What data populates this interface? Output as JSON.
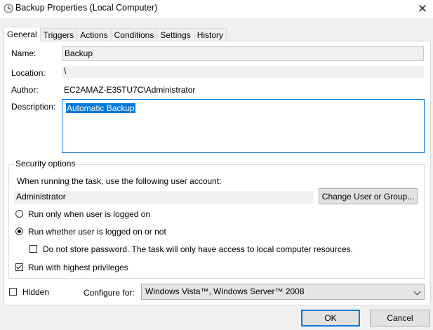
{
  "window": {
    "title": "Backup Properties (Local Computer)",
    "close_glyph": "✕"
  },
  "tabs": [
    {
      "label": "General",
      "active": true
    },
    {
      "label": "Triggers"
    },
    {
      "label": "Actions"
    },
    {
      "label": "Conditions"
    },
    {
      "label": "Settings"
    },
    {
      "label": "History"
    }
  ],
  "general": {
    "name_label": "Name:",
    "name_value": "Backup",
    "location_label": "Location:",
    "location_value": "\\",
    "author_label": "Author:",
    "author_value": "EC2AMAZ-E35TU7C\\Administrator",
    "description_label": "Description:",
    "description_value": "Automatic Backup"
  },
  "security": {
    "group_title": "Security options",
    "account_prompt": "When running the task, use the following user account:",
    "account_value": "Administrator",
    "change_button": "Change User or Group...",
    "radio_logged_on": "Run only when user is logged on",
    "radio_whether": "Run whether user is logged on or not",
    "do_not_store": "Do not store password.  The task will only have access to local computer resources.",
    "highest_privileges": "Run with highest privileges"
  },
  "footer": {
    "hidden_label": "Hidden",
    "configure_label": "Configure for:",
    "configure_value": "Windows Vista™, Windows Server™ 2008",
    "ok_button": "OK",
    "cancel_button": "Cancel"
  },
  "colors": {
    "accent": "#0078d7"
  }
}
